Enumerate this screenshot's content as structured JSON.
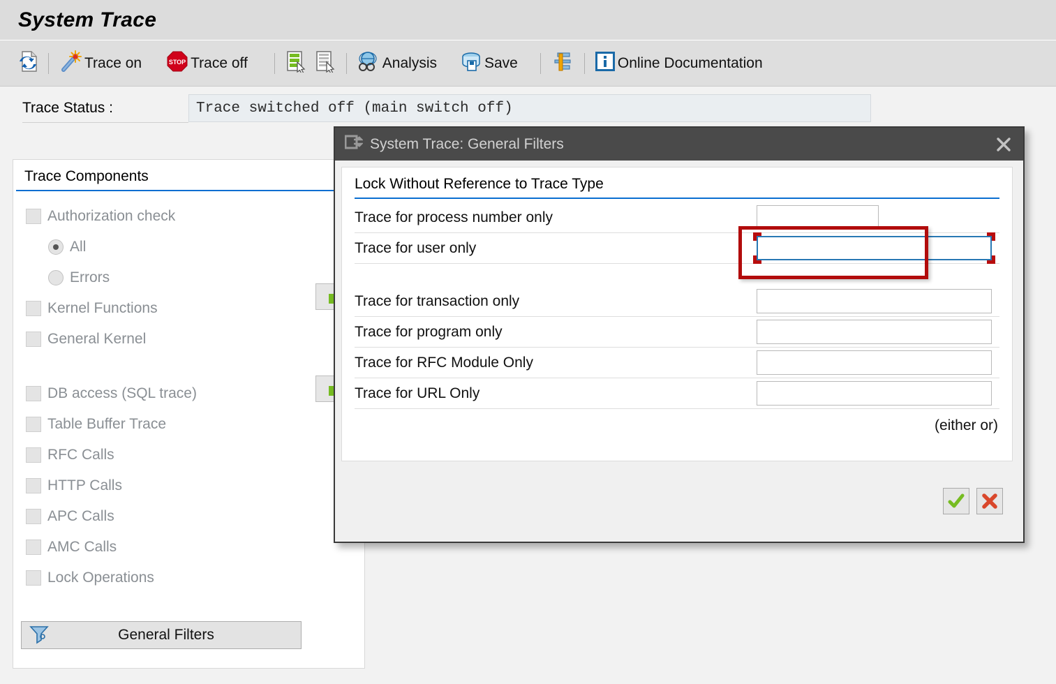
{
  "app": {
    "title": "System Trace"
  },
  "toolbar": {
    "items": [
      {
        "icon": "refresh-document-icon",
        "label": ""
      },
      {
        "icon": "magic-wand-icon",
        "label": "Trace on"
      },
      {
        "icon": "stop-sign-icon",
        "label": "Trace off"
      },
      {
        "icon": "green-list-cursor-icon",
        "label": ""
      },
      {
        "icon": "gray-list-cursor-icon",
        "label": ""
      },
      {
        "icon": "binoculars-globe-icon",
        "label": "Analysis"
      },
      {
        "icon": "save-disk-icon",
        "label": "Save"
      },
      {
        "icon": "hammer-wrench-icon",
        "label": ""
      },
      {
        "icon": "info-icon",
        "label": "Online Documentation"
      }
    ]
  },
  "status": {
    "label": "Trace Status :",
    "value": "Trace switched off (main switch off)"
  },
  "trace_components": {
    "header": "Trace Components",
    "items": [
      {
        "type": "checkbox",
        "label": "Authorization check",
        "checked": false,
        "disabled": true,
        "indent": false
      },
      {
        "type": "radio",
        "label": "All",
        "checked": true,
        "disabled": true,
        "indent": true
      },
      {
        "type": "radio",
        "label": "Errors",
        "checked": false,
        "disabled": true,
        "indent": true
      },
      {
        "type": "checkbox",
        "label": "Kernel Functions",
        "checked": false,
        "disabled": true,
        "indent": false
      },
      {
        "type": "checkbox",
        "label": "General Kernel",
        "checked": false,
        "disabled": true,
        "indent": false
      }
    ],
    "items_group2": [
      {
        "type": "checkbox",
        "label": "DB access (SQL trace)",
        "checked": false,
        "disabled": true
      },
      {
        "type": "checkbox",
        "label": "Table Buffer Trace",
        "checked": false,
        "disabled": true
      },
      {
        "type": "checkbox",
        "label": "RFC Calls",
        "checked": false,
        "disabled": true
      },
      {
        "type": "checkbox",
        "label": "HTTP Calls",
        "checked": false,
        "disabled": true
      },
      {
        "type": "checkbox",
        "label": "APC Calls",
        "checked": false,
        "disabled": true
      },
      {
        "type": "checkbox",
        "label": "AMC Calls",
        "checked": false,
        "disabled": true
      },
      {
        "type": "checkbox",
        "label": "Lock Operations",
        "checked": false,
        "disabled": true
      }
    ],
    "general_filters_button": "General Filters"
  },
  "dialog": {
    "title": "System Trace: General Filters",
    "section_header": "Lock Without Reference to Trace Type",
    "fields": [
      {
        "label": "Trace for process number only",
        "value": "",
        "width": "narrow",
        "focused": false
      },
      {
        "label": "Trace for user only",
        "value": "",
        "width": "wide",
        "focused": true
      },
      {
        "label": "Trace for transaction only",
        "value": "",
        "width": "wide",
        "focused": false
      },
      {
        "label": "Trace for program only",
        "value": "",
        "width": "wide",
        "focused": false
      },
      {
        "label": "Trace for RFC Module Only",
        "value": "",
        "width": "wide",
        "focused": false
      },
      {
        "label": "Trace for URL Only",
        "value": "",
        "width": "wide",
        "focused": false
      }
    ],
    "either_or": "(either or)",
    "confirm_button": "check-icon",
    "cancel_button": "cross-icon",
    "close_button": "close-icon"
  },
  "colors": {
    "accent_blue": "#0a6ed1",
    "focus_border": "#2878b4",
    "highlight_red": "#b20c0c",
    "titlebar": "#4a4a4a",
    "page_bg": "#f2f2f2",
    "toolbar_bg": "#dedede"
  }
}
